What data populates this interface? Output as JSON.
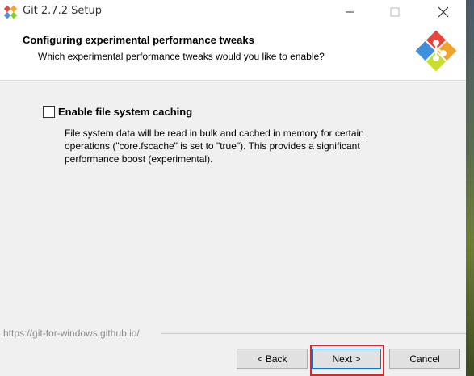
{
  "window": {
    "title": "Git 2.7.2 Setup"
  },
  "header": {
    "title": "Configuring experimental performance tweaks",
    "subtitle": "Which experimental performance tweaks would you like to enable?"
  },
  "option": {
    "label": "Enable file system caching",
    "checked": false,
    "description": "File system data will be read in bulk and cached in memory for certain operations (\"core.fscache\" is set to \"true\"). This provides a significant performance boost (experimental)."
  },
  "footer": {
    "link": "https://git-for-windows.github.io/"
  },
  "buttons": {
    "back": "< Back",
    "next": "Next >",
    "cancel": "Cancel"
  },
  "icons": {
    "app": "git-logo-icon",
    "minimize": "minimize-icon",
    "maximize": "maximize-icon",
    "close": "close-icon",
    "header_logo": "git-setup-logo-icon"
  },
  "colors": {
    "highlight": "#d9262e",
    "focus": "#0078d7"
  }
}
